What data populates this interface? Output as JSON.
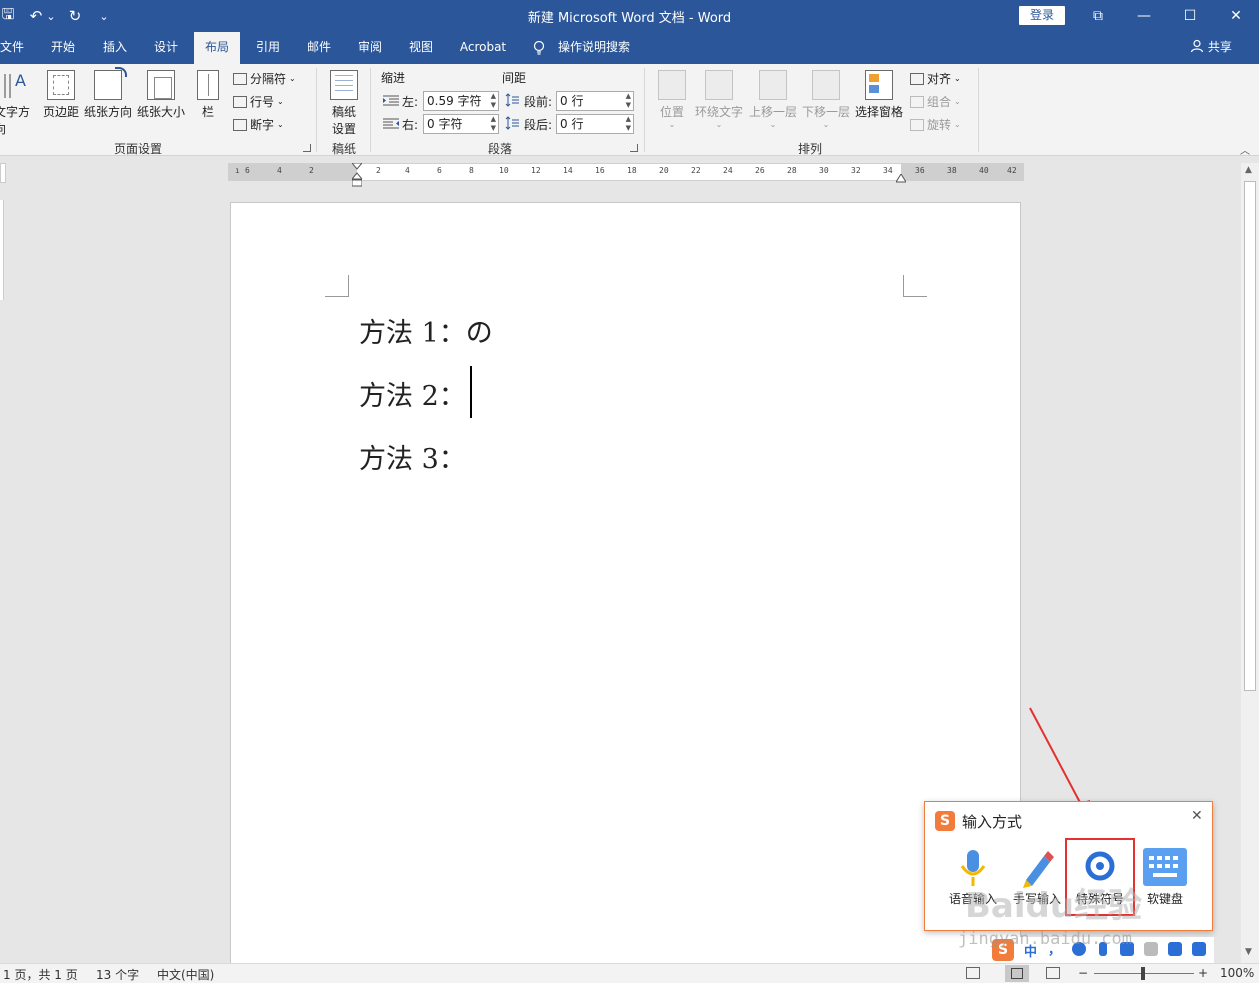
{
  "window": {
    "title": "新建 Microsoft Word 文档 - Word",
    "login_label": "登录",
    "controls": {
      "restore_ribbon": "⧉",
      "minimize": "—",
      "maximize": "☐",
      "close": "✕"
    }
  },
  "quick_access": {
    "save": "🖫",
    "undo": "↶",
    "undo_dropdown": "⌄",
    "redo": "↻",
    "customize": "⌄"
  },
  "tabs": [
    "文件",
    "开始",
    "插入",
    "设计",
    "布局",
    "引用",
    "邮件",
    "审阅",
    "视图",
    "Acrobat"
  ],
  "active_tab": "布局",
  "tell_me": "操作说明搜索",
  "share_label": "共享",
  "ribbon": {
    "page_setup": {
      "label": "页面设置",
      "buttons": [
        "文字方向",
        "页边距",
        "纸张方向",
        "纸张大小",
        "栏"
      ],
      "small": [
        "分隔符",
        "行号",
        "断字"
      ]
    },
    "manuscript": {
      "label": "稿纸",
      "button_line1": "稿纸",
      "button_line2": "设置"
    },
    "paragraph": {
      "label": "段落",
      "indent_header": "缩进",
      "spacing_header": "间距",
      "indent_left_label": "左:",
      "indent_left_value": "0.59 字符",
      "indent_right_label": "右:",
      "indent_right_value": "0 字符",
      "space_before_label": "段前:",
      "space_before_value": "0 行",
      "space_after_label": "段后:",
      "space_after_value": "0 行"
    },
    "arrange": {
      "label": "排列",
      "buttons": [
        "位置",
        "环绕文字",
        "上移一层",
        "下移一层",
        "选择窗格"
      ],
      "small": [
        "对齐",
        "组合",
        "旋转"
      ]
    }
  },
  "ruler": {
    "left_ticks": [
      "6",
      "4",
      "2"
    ],
    "ticks": [
      "2",
      "4",
      "6",
      "8",
      "10",
      "12",
      "14",
      "16",
      "18",
      "20",
      "22",
      "24",
      "26",
      "28",
      "30",
      "32",
      "34",
      "36",
      "38",
      "40",
      "42"
    ]
  },
  "document": {
    "lines": [
      "方法 1：の",
      "方法 2：",
      "方法 3："
    ]
  },
  "ime_popup": {
    "title": "输入方式",
    "close": "✕",
    "tools": [
      "语音输入",
      "手写输入",
      "特殊符号",
      "软键盘"
    ],
    "watermark": "Baidu经验",
    "url_watermark": "jingyan.baidu.com",
    "tray_labels": [
      "中",
      "，"
    ]
  },
  "status": {
    "page": "1 页，共 1 页",
    "words": "13 个字",
    "language": "中文(中国)",
    "zoom": "100%",
    "zoom_minus": "−",
    "zoom_plus": "+"
  },
  "colors": {
    "word_blue": "#2b579a",
    "ribbon_bg": "#f3f3f3",
    "highlight_red": "#e53030",
    "sogou_orange": "#f17c3b"
  }
}
